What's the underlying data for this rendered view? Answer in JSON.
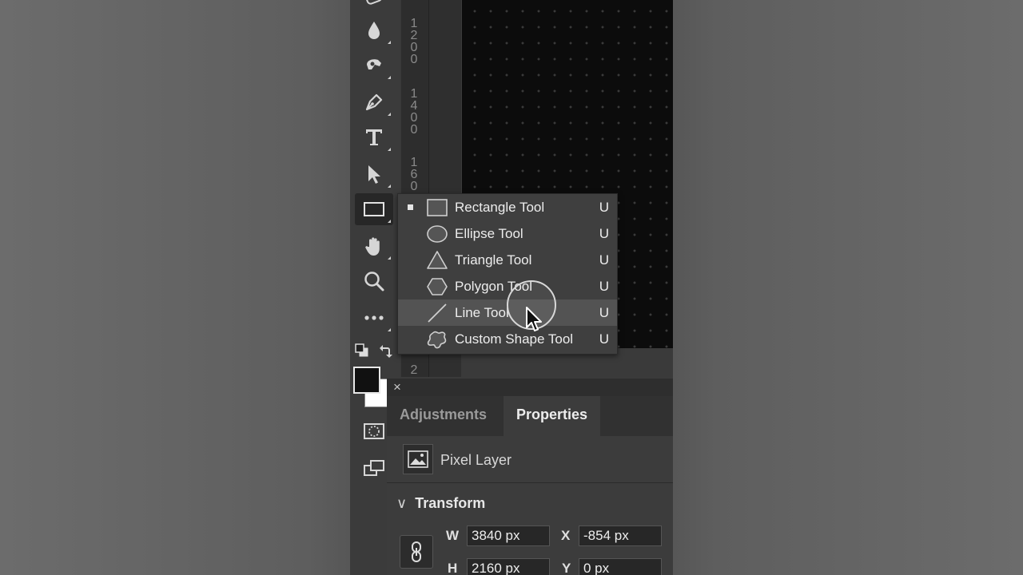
{
  "ruler": {
    "labels": [
      "1\n2\n0\n0",
      "1\n4\n0\n0",
      "1\n6\n0\n0",
      "2"
    ]
  },
  "toolbar": {
    "tools": [
      "blur-tool",
      "smudge-tool",
      "pen-tool",
      "type-tool",
      "path-selection-tool",
      "rectangle-tool",
      "hand-tool",
      "zoom-tool",
      "edit-toolbar"
    ],
    "foreground_color": "#111111",
    "background_color": "#ffffff"
  },
  "flyout": {
    "items": [
      {
        "label": "Rectangle Tool",
        "shortcut": "U",
        "icon": "rectangle-icon",
        "checked": true
      },
      {
        "label": "Ellipse Tool",
        "shortcut": "U",
        "icon": "ellipse-icon"
      },
      {
        "label": "Triangle Tool",
        "shortcut": "U",
        "icon": "triangle-icon"
      },
      {
        "label": "Polygon Tool",
        "shortcut": "U",
        "icon": "polygon-icon"
      },
      {
        "label": "Line Tool",
        "shortcut": "U",
        "icon": "line-icon",
        "hovered": true
      },
      {
        "label": "Custom Shape Tool",
        "shortcut": "U",
        "icon": "custom-shape-icon"
      }
    ]
  },
  "panel": {
    "close": "×",
    "tabs": {
      "adjustments": "Adjustments",
      "properties": "Properties"
    },
    "layer_type": "Pixel Layer",
    "section_title": "Transform",
    "fields": {
      "w_label": "W",
      "w_value": "3840 px",
      "x_label": "X",
      "x_value": "-854 px",
      "h_label": "H",
      "h_value": "2160 px",
      "y_label": "Y",
      "y_value": "0 px"
    }
  }
}
